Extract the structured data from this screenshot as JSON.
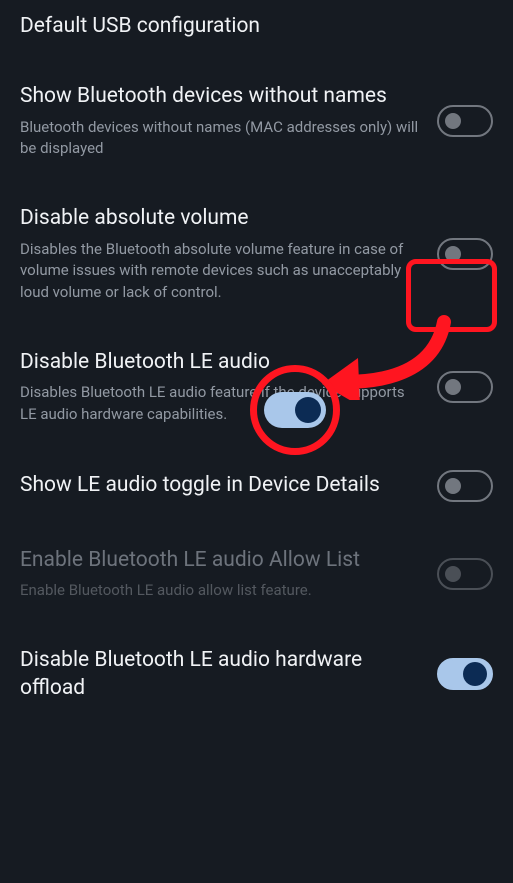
{
  "settings": [
    {
      "title": "Default USB configuration",
      "subtitle": "",
      "toggle": null,
      "enabled": true
    },
    {
      "title": "Show Bluetooth devices without names",
      "subtitle": "Bluetooth devices without names (MAC addresses only) will be displayed",
      "toggle": "off",
      "enabled": true
    },
    {
      "title": "Disable absolute volume",
      "subtitle": "Disables the Bluetooth absolute volume feature in case of volume issues with remote devices such as unacceptably loud volume or lack of control.",
      "toggle": "off",
      "enabled": true
    },
    {
      "title": "Disable Bluetooth LE audio",
      "subtitle": "Disables Bluetooth LE audio feature if the device supports LE audio hardware capabilities.",
      "toggle": "off",
      "enabled": true
    },
    {
      "title": "Show LE audio toggle in Device Details",
      "subtitle": "",
      "toggle": "off",
      "enabled": true
    },
    {
      "title": "Enable Bluetooth LE audio Allow List",
      "subtitle": "Enable Bluetooth LE audio allow list feature.",
      "toggle": "off",
      "enabled": false
    },
    {
      "title": "Disable Bluetooth LE audio hardware offload",
      "subtitle": "",
      "toggle": "on",
      "enabled": true
    }
  ],
  "annotation": {
    "highlight_target": "Disable absolute volume toggle",
    "demo_state": "on"
  },
  "colors": {
    "background": "#161b22",
    "text_primary": "#f0f2f5",
    "text_secondary": "#9299a3",
    "toggle_off_border": "#72777f",
    "toggle_on_track": "#a9c7ea",
    "toggle_on_thumb": "#0c2b54",
    "annotation_red": "#ff1520"
  }
}
